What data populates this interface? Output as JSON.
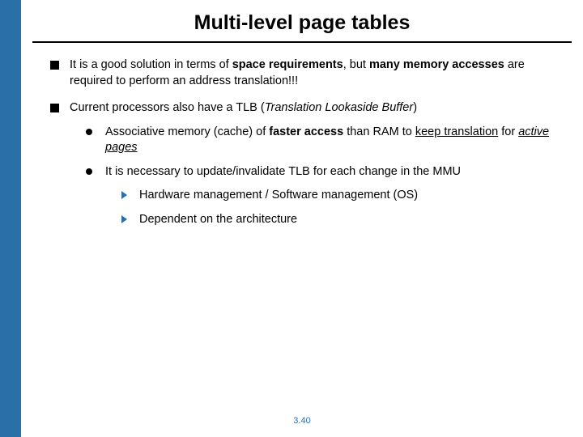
{
  "title": "Multi-level page tables",
  "b1": {
    "pre": "It is a good solution in terms of ",
    "bold1": "space requirements",
    "mid": ", but ",
    "bold2": "many memory accesses",
    "post": " are required to perform an address translation!!!"
  },
  "b2": {
    "pre": "Current processors also have a TLB (",
    "ital": "Translation Lookaside Buffer",
    "post": ")"
  },
  "b2a": {
    "pre": "Associative memory (cache) of ",
    "bold1": "faster access",
    "mid1": " than RAM to ",
    "u1": "keep translation",
    "mid2": " for ",
    "iu": "active pages"
  },
  "b2b": "It is necessary to update/invalidate TLB for each change in the  MMU",
  "b2b1": "Hardware management / Software management (OS)",
  "b2b2": "Dependent on the architecture",
  "pagenum": "3.40"
}
